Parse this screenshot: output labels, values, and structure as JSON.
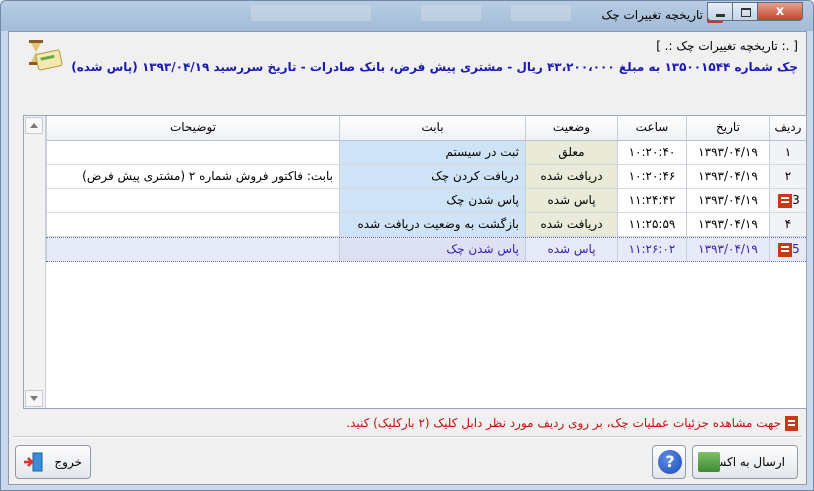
{
  "window": {
    "title": "تاریخچه تغییرات چک",
    "close_glyph": "x"
  },
  "header": {
    "section_label": "[ .: تاریخچه تغییرات چک :. ]",
    "summary": "چک شماره ۱۳۵۰۰۱۵۴۴ به مبلغ ۴۳،۲۰۰،۰۰۰ ریال - مشتری پیش فرض، بانک صادرات - تاریخ سررسید ۱۳۹۳/۰۴/۱۹ (پاس شده)"
  },
  "grid": {
    "columns": {
      "radif": "ردیف",
      "date": "تاریخ",
      "time": "ساعت",
      "status": "وضعیت",
      "babat": "بابت",
      "desc": "توضیحات"
    },
    "rows": [
      {
        "radif": "۱",
        "date": "۱۳۹۳/۰۴/۱۹",
        "time": "۱۰:۲۰:۴۰",
        "status": "معلق",
        "babat": "ثبت در سیستم",
        "desc": ""
      },
      {
        "radif": "۲",
        "date": "۱۳۹۳/۰۴/۱۹",
        "time": "۱۰:۲۰:۴۶",
        "status": "دریافت شده",
        "babat": "دریافت کردن چک",
        "desc": "بابت: فاکتور فروش شماره ۲ (مشتری پیش فرض)"
      },
      {
        "radif": "3",
        "date": "۱۳۹۳/۰۴/۱۹",
        "time": "۱۱:۲۴:۴۲",
        "status": "پاس شده",
        "babat": "پاس شدن چک",
        "desc": ""
      },
      {
        "radif": "۴",
        "date": "۱۳۹۳/۰۴/۱۹",
        "time": "۱۱:۲۵:۵۹",
        "status": "دریافت شده",
        "babat": "بازگشت به وضعیت دریافت شده",
        "desc": ""
      },
      {
        "radif": "5",
        "date": "۱۳۹۳/۰۴/۱۹",
        "time": "۱۱:۲۶:۰۲",
        "status": "پاس شده",
        "babat": "پاس شدن چک",
        "desc": ""
      }
    ]
  },
  "hint": "جهت مشاهده جزئیات عملیات چک، بر روی ردیف مورد نظر دابل کلیک (۲ بارکلیک) کنید.",
  "buttons": {
    "excel": "ارسال به اکسل",
    "help": "?",
    "exit": "خروج"
  },
  "colors": {
    "title_accent": "#1a1ab0",
    "hint": "#c21010",
    "babat_bg": "#cfe3f6",
    "status_bg": "#e9ead8",
    "selected_text": "#3a1fa8"
  }
}
